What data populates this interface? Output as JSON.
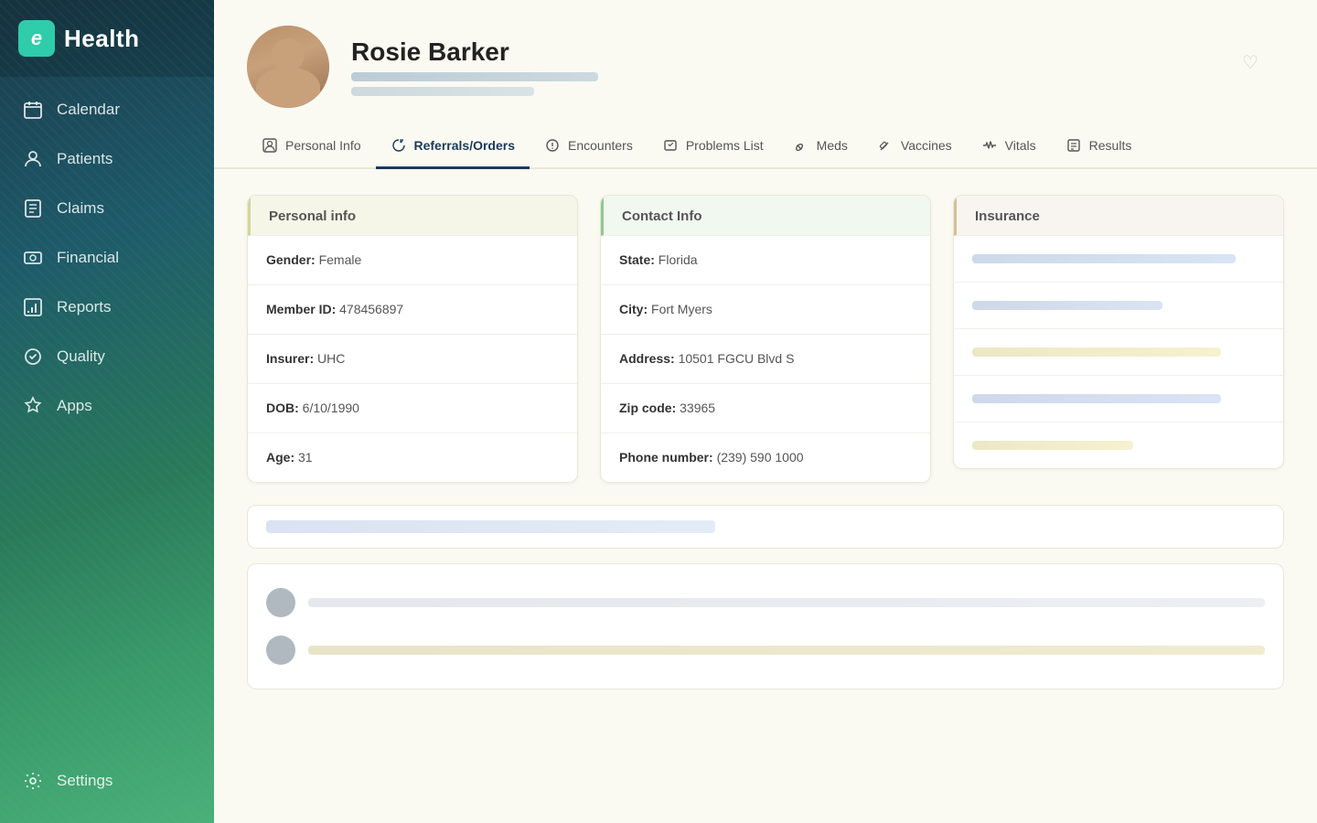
{
  "app": {
    "logo_letter": "e",
    "logo_name": "Health"
  },
  "sidebar": {
    "items": [
      {
        "id": "calendar",
        "label": "Calendar",
        "icon": "calendar"
      },
      {
        "id": "patients",
        "label": "Patients",
        "icon": "patients"
      },
      {
        "id": "claims",
        "label": "Claims",
        "icon": "claims"
      },
      {
        "id": "financial",
        "label": "Financial",
        "icon": "financial"
      },
      {
        "id": "reports",
        "label": "Reports",
        "icon": "reports"
      },
      {
        "id": "quality",
        "label": "Quality",
        "icon": "quality"
      },
      {
        "id": "apps",
        "label": "Apps",
        "icon": "apps"
      }
    ],
    "bottom_item": {
      "id": "settings",
      "label": "Settings",
      "icon": "settings"
    }
  },
  "patient": {
    "name": "Rosie Barker"
  },
  "tabs": [
    {
      "id": "personal-info",
      "label": "Personal Info",
      "active": false
    },
    {
      "id": "referrals-orders",
      "label": "Referrals/Orders",
      "active": true
    },
    {
      "id": "encounters",
      "label": "Encounters",
      "active": false
    },
    {
      "id": "problems-list",
      "label": "Problems List",
      "active": false
    },
    {
      "id": "meds",
      "label": "Meds",
      "active": false
    },
    {
      "id": "vaccines",
      "label": "Vaccines",
      "active": false
    },
    {
      "id": "vitals",
      "label": "Vitals",
      "active": false
    },
    {
      "id": "results",
      "label": "Results",
      "active": false
    }
  ],
  "panels": {
    "personal_info": {
      "title": "Personal info",
      "fields": [
        {
          "label": "Gender:",
          "value": "Female"
        },
        {
          "label": "Member ID:",
          "value": "478456897"
        },
        {
          "label": "Insurer:",
          "value": "UHC"
        },
        {
          "label": "DOB:",
          "value": "6/10/1990"
        },
        {
          "label": "Age:",
          "value": "31"
        }
      ]
    },
    "contact_info": {
      "title": "Contact Info",
      "fields": [
        {
          "label": "State:",
          "value": "Florida"
        },
        {
          "label": "City:",
          "value": "Fort Myers"
        },
        {
          "label": "Address:",
          "value": "10501 FGCU Blvd S"
        },
        {
          "label": "Zip code:",
          "value": "33965"
        },
        {
          "label": "Phone number:",
          "value": "(239) 590 1000"
        }
      ]
    },
    "insurance": {
      "title": "Insurance"
    }
  }
}
